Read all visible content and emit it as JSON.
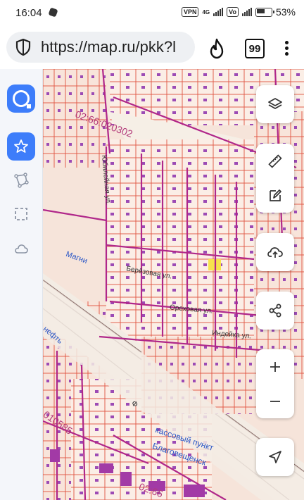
{
  "status_bar": {
    "time": "16:04",
    "vpn": "VPN",
    "net1": "4G",
    "battery": "53%"
  },
  "browser": {
    "url": "https://map.ru/pkk?l",
    "tab_count": "99"
  },
  "map": {
    "labels": {
      "cadastral_1": "02:66:020302",
      "cadastral_2": "010585",
      "cadastral_3": "02:66",
      "street_1": "Юбилейная ул.",
      "street_2": "Магни",
      "street_3": "Берёзовая ул.",
      "street_4": "Ореховая ул.",
      "street_5": "Индейка ул.",
      "poi_1": "кассовый пункт",
      "poi_2": "Благовещенск",
      "poi_3": "Ф",
      "poi_4": "нефть"
    }
  },
  "colors": {
    "accent": "#3d7dfa",
    "parcel_line": "#e0533f",
    "block_line": "#b0278a"
  }
}
